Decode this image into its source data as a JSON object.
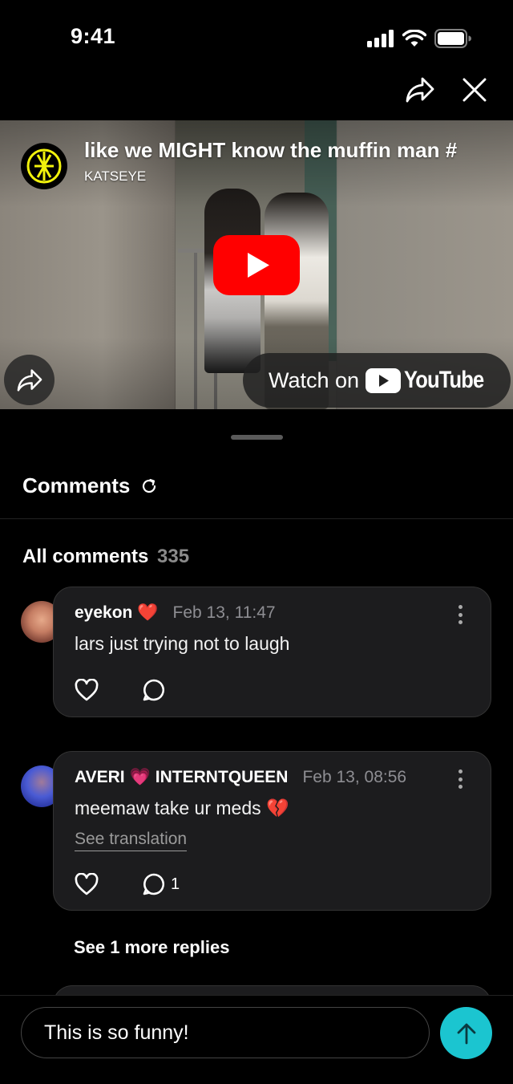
{
  "status_bar": {
    "time": "9:41"
  },
  "video": {
    "title": "like we MIGHT know the muffin man #",
    "channel": "KATSEYE",
    "watch_on": "Watch on",
    "youtube_wordmark": "YouTube"
  },
  "comments": {
    "header": "Comments",
    "all_label": "All comments",
    "total": "335",
    "items": [
      {
        "user": "eyekon",
        "emoji": "❤️",
        "time": "Feb 13, 11:47",
        "text": "lars just trying not to laugh"
      },
      {
        "user_part1": "AVERI",
        "emoji": "💗",
        "user_part2": "INTERNTQUEEN",
        "time": "Feb 13, 08:56",
        "text": "meemaw take ur meds",
        "text_emoji": "💔",
        "translate": "See translation",
        "reply_count": "1"
      }
    ],
    "see_more": "See 1 more replies"
  },
  "composer": {
    "value": "This is so funny!"
  },
  "colors": {
    "accent": "#1bc5d0",
    "youtube_red": "#ff0000",
    "card_bg": "#1c1c1e"
  }
}
